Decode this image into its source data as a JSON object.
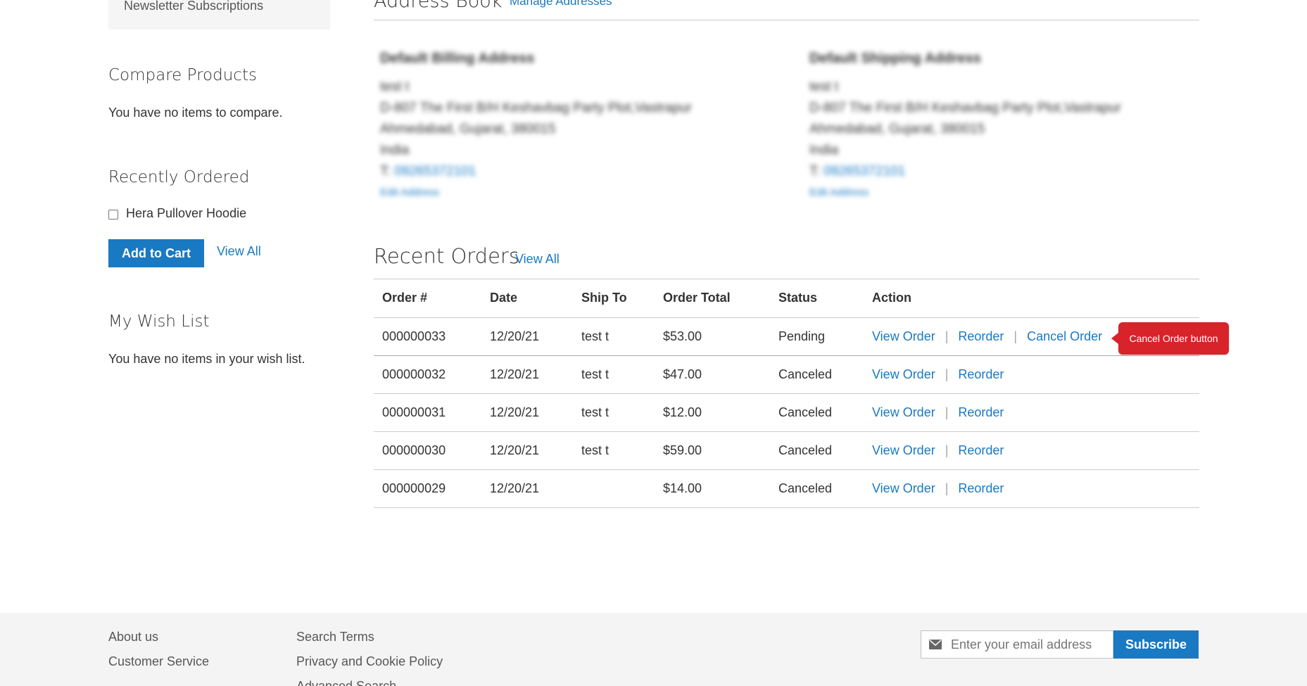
{
  "sidebar": {
    "nav_tail": "Newsletter Subscriptions",
    "compare": {
      "title": "Compare Products",
      "empty": "You have no items to compare."
    },
    "recently_ordered": {
      "title": "Recently Ordered",
      "item": "Hera Pullover Hoodie",
      "add_to_cart": "Add to Cart",
      "view_all": "View All"
    },
    "wishlist": {
      "title": "My Wish List",
      "empty": "You have no items in your wish list."
    }
  },
  "address_book": {
    "title": "Address Book",
    "manage": "Manage Addresses",
    "billing": {
      "title": "Default Billing Address",
      "name": "test t",
      "street": "D-807 The First B/H Keshavbag Party Plot,Vastrapur",
      "city": "Ahmedabad, Gujarat, 380015",
      "country": "India",
      "phone_prefix": "T:",
      "phone": "09265372101",
      "edit": "Edit Address"
    },
    "shipping": {
      "title": "Default Shipping Address",
      "name": "test t",
      "street": "D-807 The First B/H Keshavbag Party Plot,Vastrapur",
      "city": "Ahmedabad, Gujarat, 380015",
      "country": "India",
      "phone_prefix": "T:",
      "phone": "09265372101",
      "edit": "Edit Address"
    }
  },
  "recent_orders": {
    "title": "Recent Orders",
    "view_all": "View All",
    "headers": [
      "Order #",
      "Date",
      "Ship To",
      "Order Total",
      "Status",
      "Action"
    ],
    "actions": {
      "view": "View Order",
      "reorder": "Reorder",
      "cancel": "Cancel Order"
    },
    "rows": [
      {
        "order": "000000033",
        "date": "12/20/21",
        "ship_to": "test t",
        "total": "$53.00",
        "status": "Pending"
      },
      {
        "order": "000000032",
        "date": "12/20/21",
        "ship_to": "test t",
        "total": "$47.00",
        "status": "Canceled"
      },
      {
        "order": "000000031",
        "date": "12/20/21",
        "ship_to": "test t",
        "total": "$12.00",
        "status": "Canceled"
      },
      {
        "order": "000000030",
        "date": "12/20/21",
        "ship_to": "test t",
        "total": "$59.00",
        "status": "Canceled"
      },
      {
        "order": "000000029",
        "date": "12/20/21",
        "ship_to": "",
        "total": "$14.00",
        "status": "Canceled"
      }
    ]
  },
  "tooltip": "Cancel Order button",
  "footer": {
    "links_col1": [
      "About us",
      "Customer Service"
    ],
    "links_col2": [
      "Search Terms",
      "Privacy and Cookie Policy",
      "Advanced Search"
    ],
    "newsletter_placeholder": "Enter your email address",
    "subscribe": "Subscribe",
    "icon": "envelope-icon"
  },
  "colors": {
    "link": "#1979c3",
    "primary_button": "#1979c3",
    "tooltip": "#d8232a"
  }
}
